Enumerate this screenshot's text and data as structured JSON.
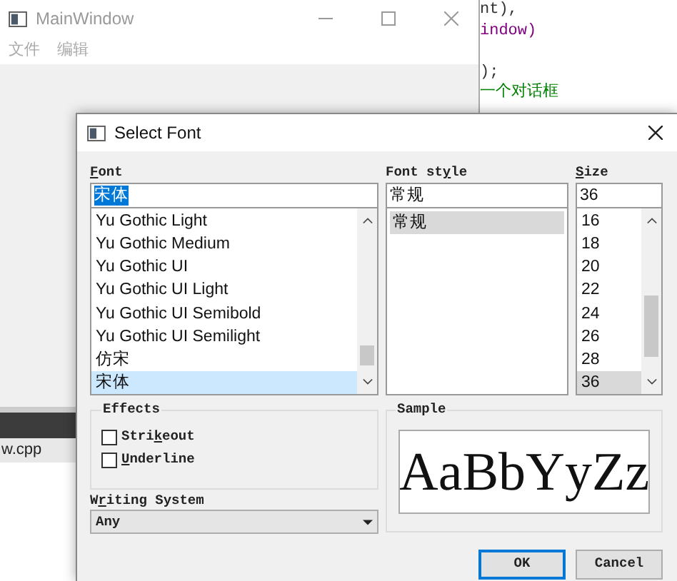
{
  "main_window": {
    "title": "MainWindow",
    "menu": [
      "文件",
      "编辑"
    ]
  },
  "editor": {
    "lines": [
      {
        "text": "nt),",
        "kind": "plain"
      },
      {
        "text": "indow)",
        "kind": "purple"
      },
      {
        "text": ");",
        "kind": "plain",
        "gap_before": true
      },
      {
        "text": "一个对话框",
        "kind": "comment"
      }
    ]
  },
  "file_tab": {
    "label": "w.cpp"
  },
  "dialog": {
    "title": "Select Font",
    "font": {
      "label_parts": {
        "key": "F",
        "after": "ont"
      },
      "value": "宋体",
      "value_highlighted": true,
      "items": [
        {
          "text": "Yu Gothic Light",
          "selected": false
        },
        {
          "text": "Yu Gothic Medium",
          "selected": false
        },
        {
          "text": "Yu Gothic UI",
          "selected": false
        },
        {
          "text": "Yu Gothic UI Light",
          "selected": false
        },
        {
          "text": "Yu Gothic UI Semibold",
          "selected": false
        },
        {
          "text": "Yu Gothic UI Semilight",
          "selected": false
        },
        {
          "text": "仿宋",
          "selected": false
        },
        {
          "text": "宋体",
          "selected": true
        }
      ]
    },
    "style": {
      "label_parts": {
        "before": "Font st",
        "key": "y",
        "after": "le"
      },
      "value": "常规",
      "items": [
        {
          "text": "常规",
          "selected": true
        }
      ]
    },
    "size": {
      "label_parts": {
        "key": "S",
        "after": "ize"
      },
      "value": "36",
      "items": [
        {
          "text": "16",
          "selected": false
        },
        {
          "text": "18",
          "selected": false
        },
        {
          "text": "20",
          "selected": false
        },
        {
          "text": "22",
          "selected": false
        },
        {
          "text": "24",
          "selected": false
        },
        {
          "text": "26",
          "selected": false
        },
        {
          "text": "28",
          "selected": false
        },
        {
          "text": "36",
          "selected": true
        }
      ]
    },
    "effects": {
      "title": "Effects",
      "options": [
        {
          "label_parts": {
            "before": "Stri",
            "key": "k",
            "after": "eout"
          },
          "checked": false
        },
        {
          "label_parts": {
            "key": "U",
            "after": "nderline"
          },
          "checked": false
        }
      ]
    },
    "writing_system": {
      "label_parts": {
        "before": "W",
        "key": "r",
        "after": "iting System"
      },
      "value": "Any"
    },
    "sample": {
      "title": "Sample",
      "text": "AaBbYyZz"
    },
    "buttons": [
      {
        "label": "OK",
        "default": true
      },
      {
        "label": "Cancel",
        "default": false
      }
    ]
  }
}
